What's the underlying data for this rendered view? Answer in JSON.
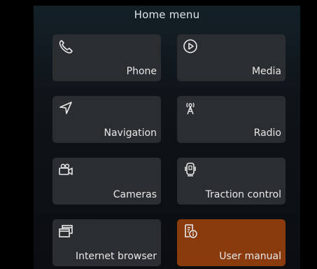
{
  "header": {
    "title": "Home menu"
  },
  "tiles": [
    {
      "label": "Phone",
      "icon": "phone-icon"
    },
    {
      "label": "Media",
      "icon": "play-icon"
    },
    {
      "label": "Navigation",
      "icon": "navigation-arrow-icon"
    },
    {
      "label": "Radio",
      "icon": "radio-antenna-icon"
    },
    {
      "label": "Cameras",
      "icon": "camera-icon"
    },
    {
      "label": "Traction control",
      "icon": "traction-control-icon"
    },
    {
      "label": "Internet browser",
      "icon": "browser-windows-icon"
    },
    {
      "label": "User manual",
      "icon": "manual-info-icon",
      "active": true
    }
  ],
  "colors": {
    "tile": "#2a2e31",
    "active_tile": "#8a3b0d",
    "text": "#e6e8ea"
  }
}
